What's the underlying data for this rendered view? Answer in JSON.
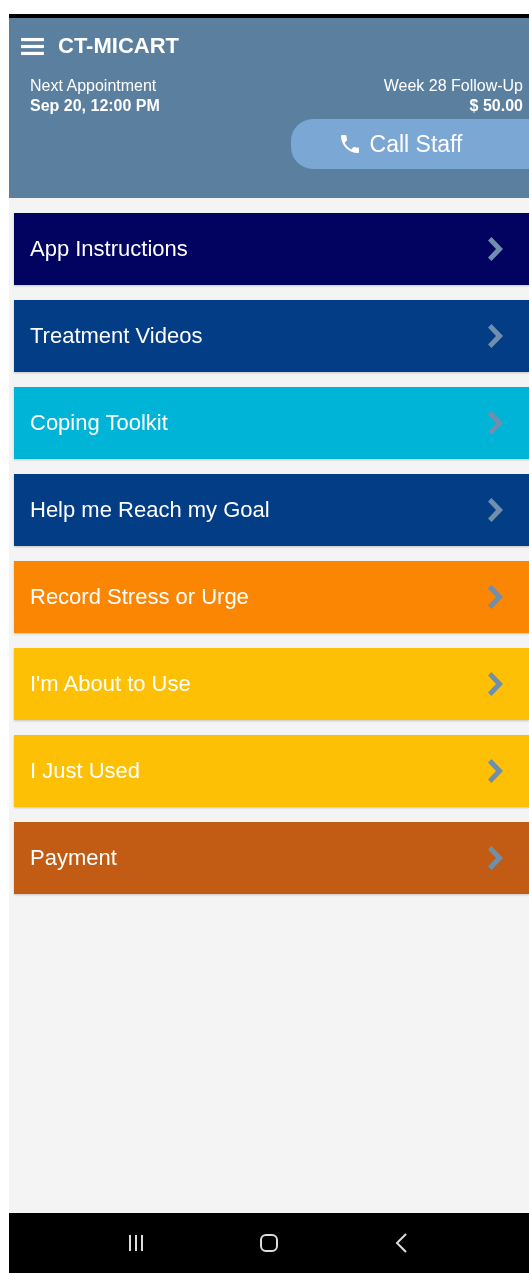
{
  "app_bar": {
    "title": "CT-MICART"
  },
  "appointment": {
    "label": "Next Appointment",
    "date": "Sep 20, 12:00 PM"
  },
  "visit": {
    "label": "Week 28 Follow-Up",
    "amount": "$ 50.00"
  },
  "call_button": {
    "label": "Call Staff"
  },
  "menu_items": [
    {
      "label": "App Instructions",
      "color": "#020260"
    },
    {
      "label": "Treatment Videos",
      "color": "#033d86"
    },
    {
      "label": "Coping Toolkit",
      "color": "#00b4d8"
    },
    {
      "label": "Help me Reach my Goal",
      "color": "#033d86"
    },
    {
      "label": "Record Stress or Urge",
      "color": "#fb8604"
    },
    {
      "label": "I'm About to Use",
      "color": "#fdc004"
    },
    {
      "label": "I Just Used",
      "color": "#fdc004"
    },
    {
      "label": "Payment",
      "color": "#c25b14"
    }
  ],
  "nav_bar": {
    "buttons": [
      {
        "kind": "recents"
      },
      {
        "kind": "home"
      },
      {
        "kind": "back"
      }
    ]
  }
}
